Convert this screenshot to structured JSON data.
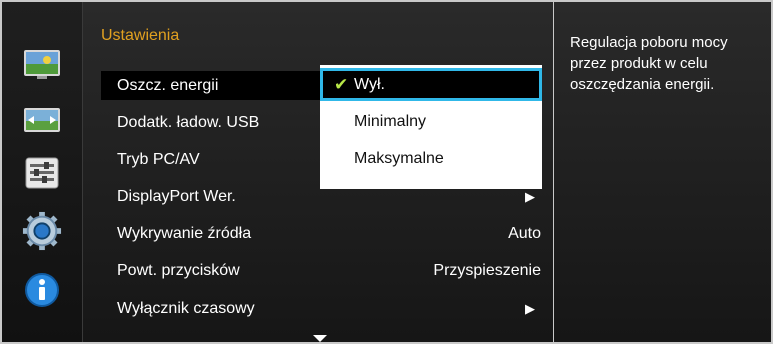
{
  "sidebar": {
    "icons": [
      "picture-icon",
      "onscreen-display-icon",
      "setup-icon",
      "system-gear-icon",
      "information-icon"
    ]
  },
  "main": {
    "title": "Ustawienia",
    "items": [
      {
        "label": "Oszcz. energii",
        "value": "",
        "arrow": ""
      },
      {
        "label": "Dodatk. ładow. USB",
        "value": "",
        "arrow": ""
      },
      {
        "label": "Tryb PC/AV",
        "value": "",
        "arrow": ""
      },
      {
        "label": "DisplayPort Wer.",
        "value": "",
        "arrow": "▶"
      },
      {
        "label": "Wykrywanie źródła",
        "value": "Auto",
        "arrow": ""
      },
      {
        "label": "Powt. przycisków",
        "value": "Przyspieszenie",
        "arrow": ""
      },
      {
        "label": "Wyłącznik czasowy",
        "value": "",
        "arrow": "▶"
      }
    ]
  },
  "submenu": {
    "checkmark": "✔",
    "options": [
      "Wył.",
      "Minimalny",
      "Maksymalne"
    ],
    "selected_index": 0
  },
  "help": {
    "text": "Regulacja poboru mocy przez produkt w celu oszczędzania energii."
  },
  "colors": {
    "title": "#e0a020",
    "focus_border": "#30b8e8",
    "check": "#b8e848"
  }
}
